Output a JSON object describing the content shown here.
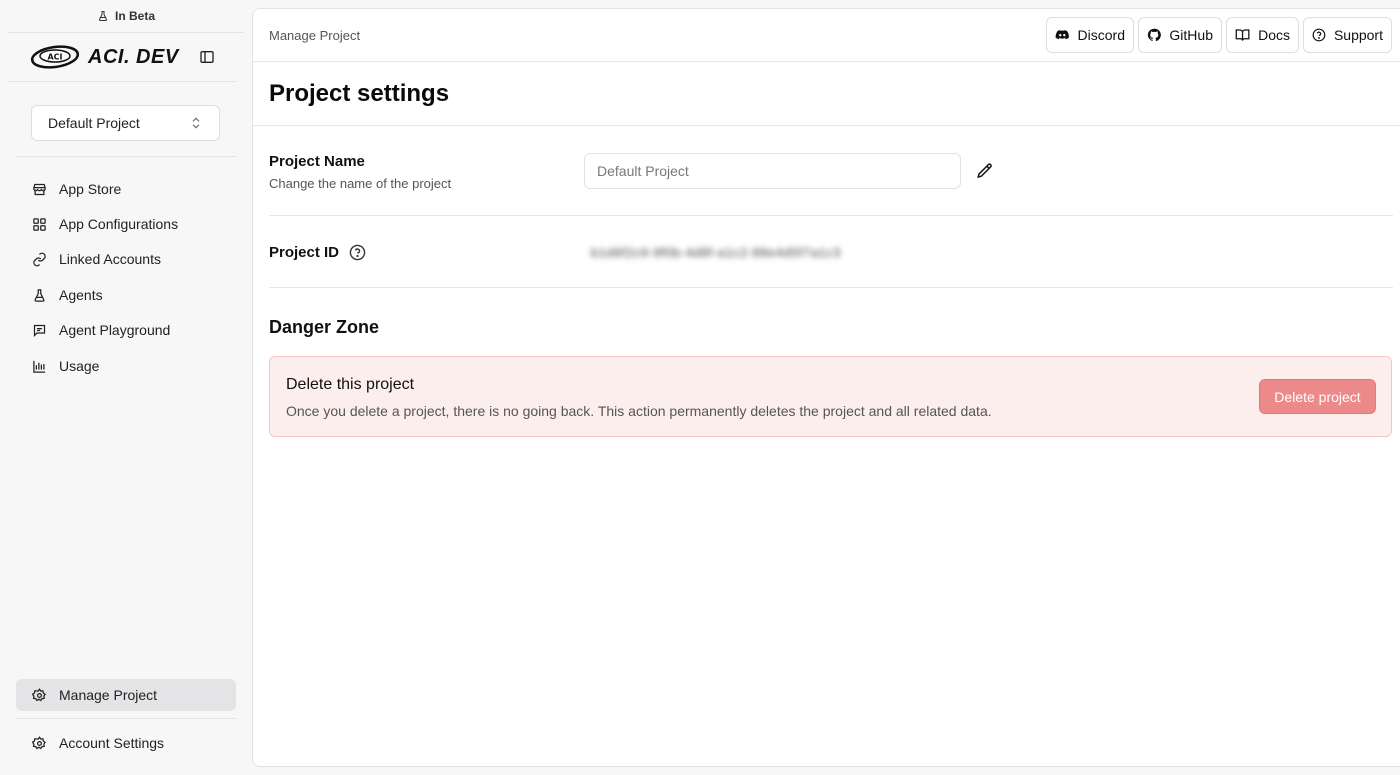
{
  "sidebar": {
    "beta_label": "In Beta",
    "brand": {
      "logo_badge": "ACI",
      "name": "ACI. DEV"
    },
    "project_selector": {
      "value": "Default Project"
    },
    "nav_items": [
      {
        "label": "App Store",
        "icon": "store-icon"
      },
      {
        "label": "App Configurations",
        "icon": "grid-icon"
      },
      {
        "label": "Linked Accounts",
        "icon": "link-icon"
      },
      {
        "label": "Agents",
        "icon": "flask-icon"
      },
      {
        "label": "Agent Playground",
        "icon": "chat-icon"
      },
      {
        "label": "Usage",
        "icon": "bar-chart-icon"
      }
    ],
    "bottom_items": [
      {
        "label": "Manage Project",
        "icon": "gear-icon",
        "active": true
      },
      {
        "label": "Account Settings",
        "icon": "gear-icon",
        "active": false
      }
    ]
  },
  "header": {
    "breadcrumb": "Manage Project",
    "links": [
      {
        "label": "Discord",
        "icon": "discord-icon"
      },
      {
        "label": "GitHub",
        "icon": "github-icon"
      },
      {
        "label": "Docs",
        "icon": "book-icon"
      },
      {
        "label": "Support",
        "icon": "help-circle-icon"
      }
    ]
  },
  "main": {
    "title": "Project settings",
    "project_name": {
      "label": "Project Name",
      "description": "Change the name of the project",
      "placeholder": "Default Project"
    },
    "project_id": {
      "label": "Project ID",
      "value": "b1d6f2c9-9f0b-4d8f-a1c2-88e4d5f7a1c3"
    },
    "danger_zone": {
      "title": "Danger Zone",
      "heading": "Delete this project",
      "description": "Once you delete a project, there is no going back. This action permanently deletes the project and all related data.",
      "button_label": "Delete project"
    }
  },
  "colors": {
    "accent_active_bg": "#e4e4e7",
    "danger_bg": "#fdeeee",
    "danger_border": "#f5c6c6",
    "danger_button": "#ec8a8a"
  }
}
